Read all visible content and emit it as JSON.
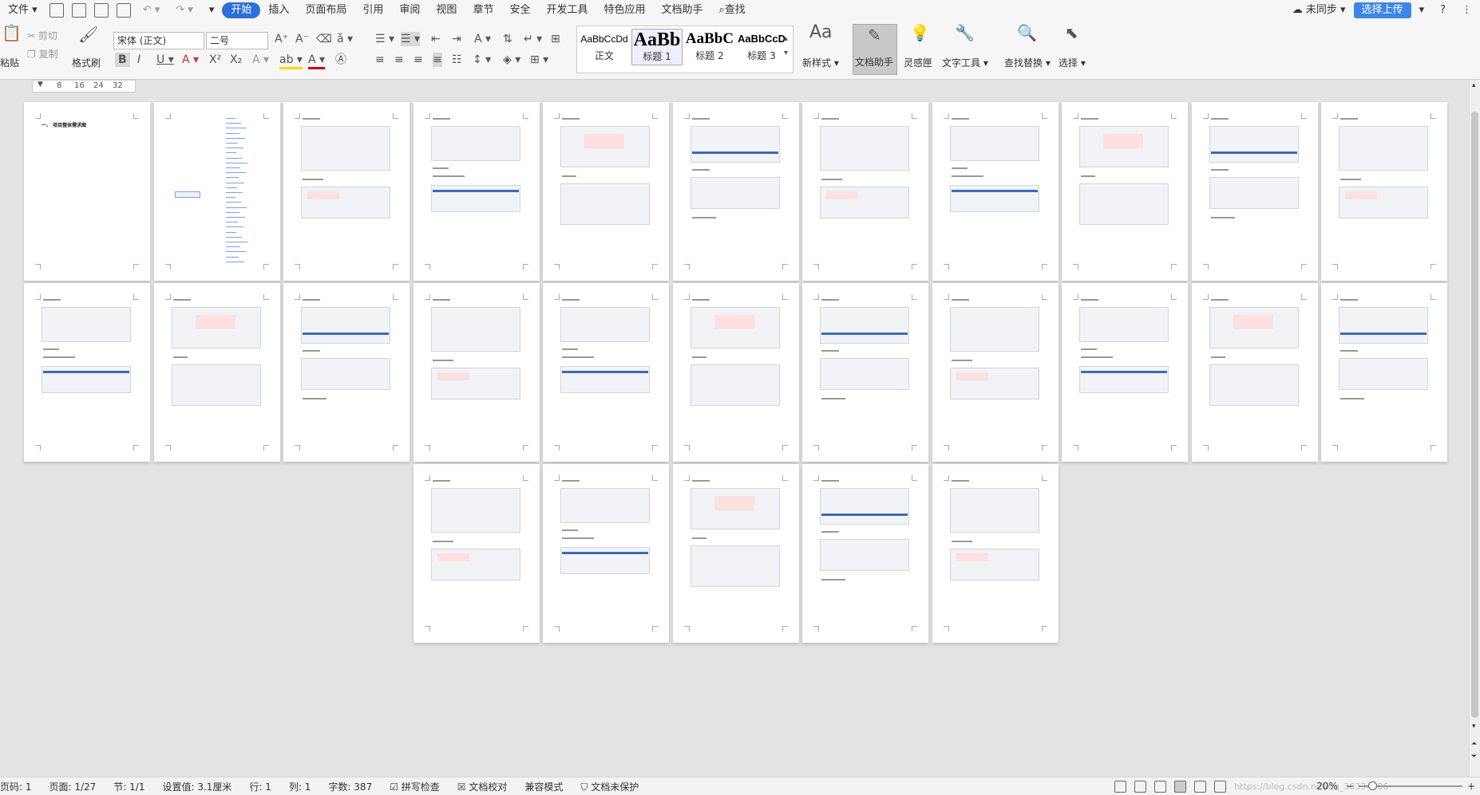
{
  "menubar": {
    "file": "文件",
    "tabs": [
      "开始",
      "插入",
      "页面布局",
      "引用",
      "审阅",
      "视图",
      "章节",
      "安全",
      "开发工具",
      "特色应用",
      "文档助手"
    ],
    "active_tab": "开始",
    "search": "查找",
    "sync": "未同步",
    "upload": "选择上传",
    "help": "?"
  },
  "ribbon": {
    "paste": "粘贴",
    "cut": "剪切",
    "copy": "复制",
    "format_painter": "格式刷",
    "font_name": "宋体 (正文)",
    "font_size": "二号",
    "styles": [
      {
        "preview": "AaBbCcDd",
        "name": "正文"
      },
      {
        "preview": "AaBb",
        "name": "标题 1"
      },
      {
        "preview": "AaBbC",
        "name": "标题 2"
      },
      {
        "preview": "AaBbCcD",
        "name": "标题 3"
      }
    ],
    "new_style": "新样式",
    "doc_assistant": "文档助手",
    "inspiration": "灵感匣",
    "text_tools": "文字工具",
    "find_replace": "查找替换",
    "select": "选择"
  },
  "ruler": [
    "8",
    "16",
    "24",
    "32"
  ],
  "document": {
    "page_count": 27,
    "page1_heading": "一、 项目整体需求图"
  },
  "status": {
    "page_no": "页码: 1",
    "page": "页面: 1/27",
    "section": "节: 1/1",
    "setting": "设置值: 3.1厘米",
    "line": "行: 1",
    "col": "列: 1",
    "words": "字数: 387",
    "spell": "拼写检查",
    "proof": "文档校对",
    "compat": "兼容模式",
    "protect": "文档未保护",
    "zoom": "20%",
    "watermark": "https://blog.csdn.net/qq_36334786"
  }
}
